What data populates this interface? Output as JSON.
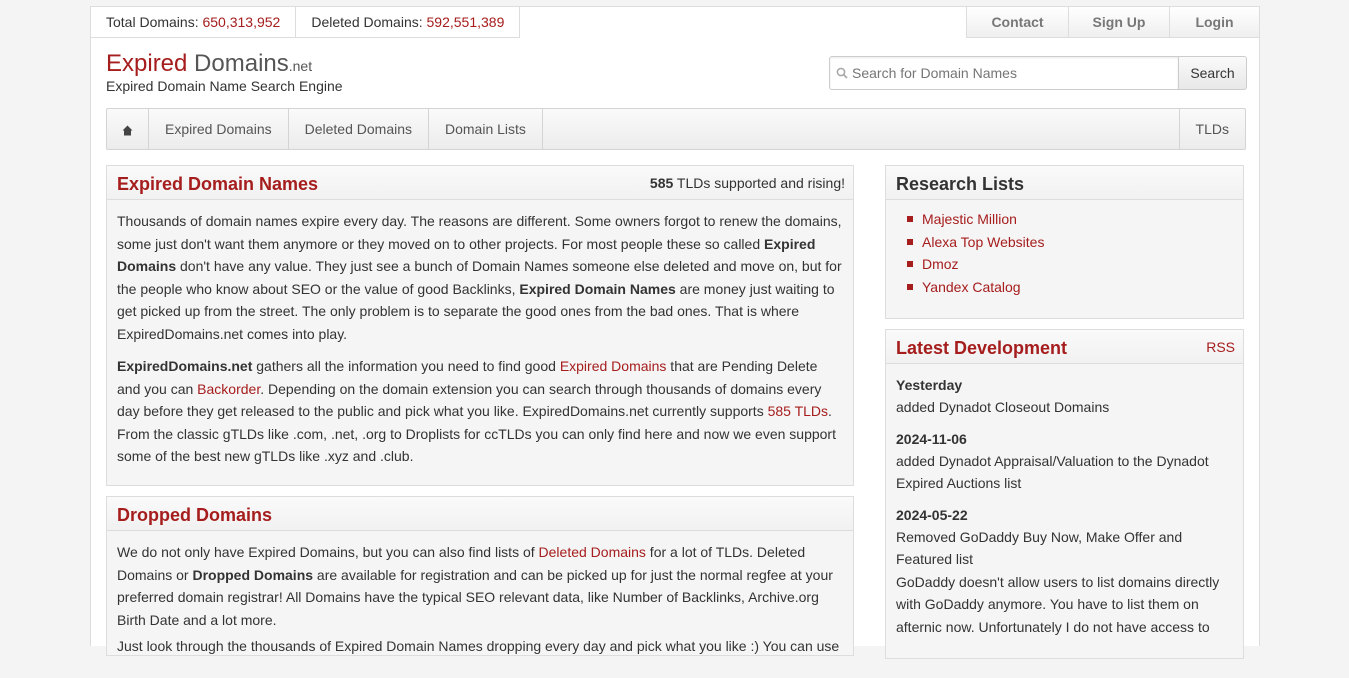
{
  "stats": {
    "total_label": "Total Domains:",
    "total_value": "650,313,952",
    "deleted_label": "Deleted Domains:",
    "deleted_value": "592,551,389"
  },
  "toplinks": [
    "Contact",
    "Sign Up",
    "Login"
  ],
  "logo": {
    "expired": "Expired",
    "domains": "Domains",
    "net": ".net",
    "subtitle": "Expired Domain Name Search Engine"
  },
  "search": {
    "placeholder": "Search for Domain Names",
    "button": "Search",
    "icon": "search-icon"
  },
  "nav": {
    "home_icon": "home-icon",
    "items": [
      "Expired Domains",
      "Deleted Domains",
      "Domain Lists"
    ],
    "right": "TLDs"
  },
  "expired_panel": {
    "title": "Expired Domain Names",
    "tld_count": "585",
    "tld_text": "TLDs supported and rising!",
    "p1_a": "Thousands of domain names expire every day. The reasons are different. Some owners forgot to renew the domains, some just don't want them anymore or they moved on to other projects. For most people these so called ",
    "p1_b": "Expired Domains",
    "p1_c": " don't have any value. They just see a bunch of Domain Names someone else deleted and move on, but for the people who know about SEO or the value of good Backlinks, ",
    "p1_d": "Expired Domain Names",
    "p1_e": " are money just waiting to get picked up from the street. The only problem is to separate the good ones from the bad ones. That is where ExpiredDomains.net comes into play.",
    "p2_a": "ExpiredDomains.net",
    "p2_b": " gathers all the information you need to find good ",
    "p2_link1": "Expired Domains",
    "p2_c": " that are Pending Delete and you can ",
    "p2_link2": "Backorder",
    "p2_d": ". Depending on the domain extension you can search through thousands of domains every day before they get released to the public and pick what you like. ExpiredDomains.net currently supports ",
    "p2_link3": "585 TLDs",
    "p2_e": ". From the classic gTLDs like .com, .net, .org to Droplists for ccTLDs you can only find here and now we even support some of the best new gTLDs like .xyz and .club."
  },
  "dropped_panel": {
    "title": "Dropped Domains",
    "p1_a": "We do not only have Expired Domains, but you can also find lists of ",
    "p1_link": "Deleted Domains",
    "p1_b": " for a lot of TLDs. Deleted Domains or ",
    "p1_c": "Dropped Domains",
    "p1_d": " are available for registration and can be picked up for just the normal regfee at your preferred domain registrar! All Domains have the typical SEO relevant data, like Number of Backlinks, Archive.org Birth Date and a lot more.",
    "p2": "Just look through the thousands of Expired Domain Names dropping every day and pick what you like :) You can use"
  },
  "research": {
    "title": "Research Lists",
    "items": [
      "Majestic Million",
      "Alexa Top Websites",
      "Dmoz",
      "Yandex Catalog"
    ]
  },
  "latest": {
    "title": "Latest Development",
    "rss": "RSS",
    "entries": [
      {
        "date": "Yesterday",
        "text": "added Dynadot Closeout Domains"
      },
      {
        "date": "2024-11-06",
        "text": "added Dynadot Appraisal/Valuation to the Dynadot Expired Auctions list"
      },
      {
        "date": "2024-05-22",
        "text": "Removed GoDaddy Buy Now, Make Offer and Featured list",
        "text2": "GoDaddy doesn't allow users to list domains directly with GoDaddy anymore. You have to list them on afternic now. Unfortunately I do not have access to"
      }
    ]
  },
  "colors": {
    "accent": "#a61d1d"
  }
}
